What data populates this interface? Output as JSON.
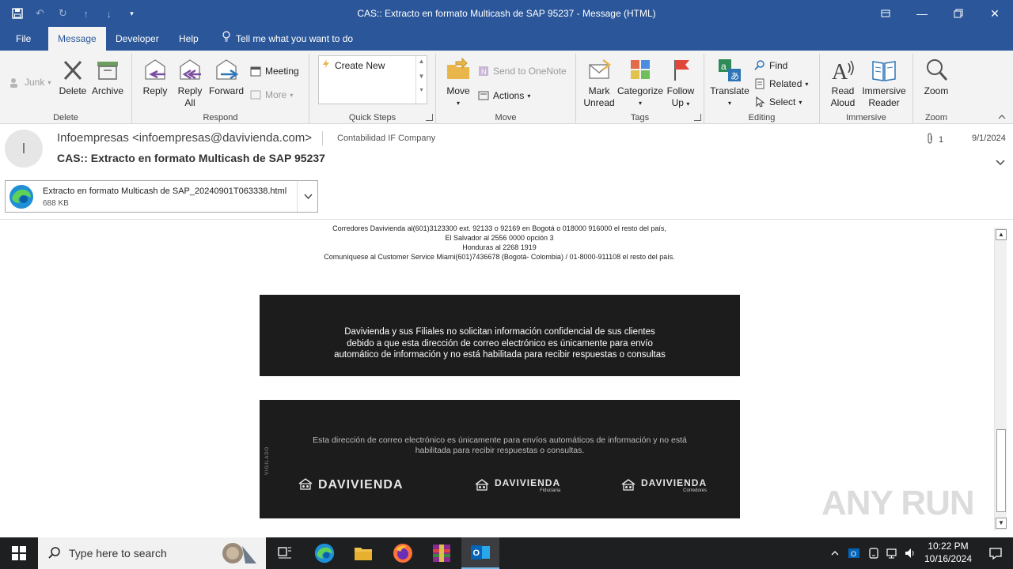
{
  "window": {
    "title": "CAS:: Extracto en formato Multicash de SAP 95237  -  Message (HTML)",
    "accent": "#2b579a"
  },
  "tabs": [
    "File",
    "Message",
    "Developer",
    "Help"
  ],
  "tell_me": "Tell me what you want to do",
  "ribbon": {
    "delete_group": {
      "label": "Delete",
      "junk": "Junk",
      "delete": "Delete",
      "archive": "Archive"
    },
    "respond_group": {
      "label": "Respond",
      "reply": "Reply",
      "reply_all_1": "Reply",
      "reply_all_2": "All",
      "forward": "Forward",
      "meeting": "Meeting",
      "more": "More"
    },
    "quick_steps_group": {
      "label": "Quick Steps",
      "create_new": "Create New"
    },
    "move_group": {
      "label": "Move",
      "move": "Move",
      "send_to_onenote": "Send to OneNote",
      "actions": "Actions"
    },
    "tags_group": {
      "label": "Tags",
      "mark_unread_1": "Mark",
      "mark_unread_2": "Unread",
      "categorize": "Categorize",
      "follow_up_1": "Follow",
      "follow_up_2": "Up"
    },
    "editing_group": {
      "label": "Editing",
      "translate": "Translate",
      "find": "Find",
      "related": "Related",
      "select": "Select"
    },
    "immersive_group": {
      "label": "Immersive",
      "read_aloud_1": "Read",
      "read_aloud_2": "Aloud",
      "immersive_reader_1": "Immersive",
      "immersive_reader_2": "Reader"
    },
    "zoom_group": {
      "label": "Zoom",
      "zoom": "Zoom"
    }
  },
  "message": {
    "avatar_initial": "I",
    "from": "Infoempresas <infoempresas@davivienda.com>",
    "to": "Contabilidad IF Company",
    "attachment_count": "1",
    "date": "9/1/2024",
    "subject": "CAS:: Extracto en formato Multicash de SAP 95237",
    "attachment": {
      "name": "Extracto en formato Multicash de SAP_20240901T063338.html",
      "size": "688 KB"
    }
  },
  "body": {
    "contact_lines": [
      "Corredores Davivienda al(601)3123300 ext. 92133 o 92169 en Bogotá o 018000 916000 el resto del país,",
      "El Salvador al 2556 0000 opción 3",
      "Honduras al 2268 1919",
      "Comuníquese al Customer Service Miami(601)7436678 (Bogotá- Colombia) / 01-8000-911108 el resto del país."
    ],
    "notice_lines": [
      "Davivienda y sus Filiales no solicitan información confidencial de sus clientes",
      "debido a que esta dirección de correo electrónico es únicamente para envío",
      "automático de información y no está habilitada para recibir respuestas o consultas"
    ],
    "footer_lines": [
      "Esta dirección de correo electrónico es únicamente para envíos automáticos de información y no está",
      "habilitada para recibir respuestas o consultas."
    ],
    "vigilado": "VIGILADO",
    "brands": [
      {
        "name": "DAVIVIENDA",
        "sub": ""
      },
      {
        "name": "DAVIVIENDA",
        "sub": "Fiduciaria"
      },
      {
        "name": "DAVIVIENDA",
        "sub": "Corredores"
      }
    ]
  },
  "watermark": "ANY RUN",
  "taskbar": {
    "search_placeholder": "Type here to search",
    "time": "10:22 PM",
    "date": "10/16/2024"
  }
}
